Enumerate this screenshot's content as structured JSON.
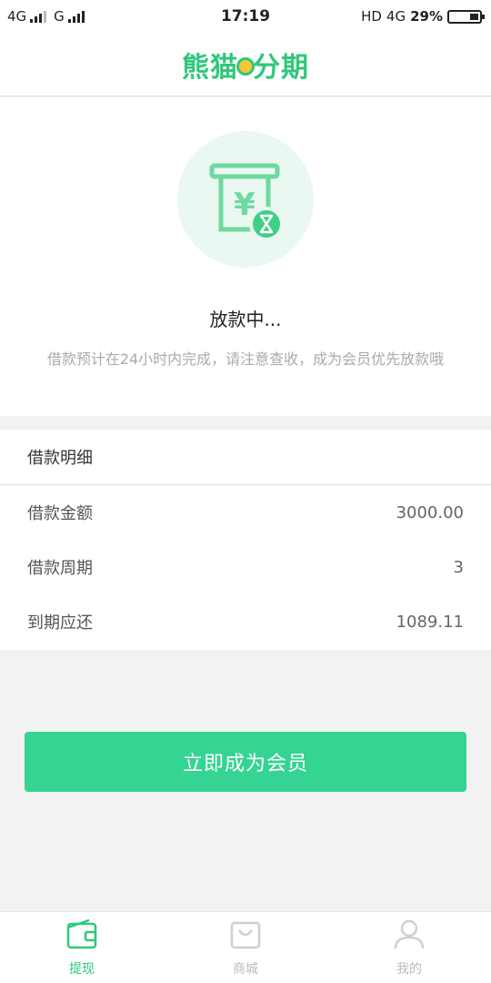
{
  "status_bar": {
    "network1": "4G",
    "network2": "G",
    "time": "17:19",
    "hd": "HD",
    "network3": "4G",
    "battery": "29%",
    "battery_level": 0.29
  },
  "header": {
    "logo_text_a": "熊猫",
    "logo_text_b": "分期"
  },
  "loan_status": {
    "icon": "atm-cash-hourglass-icon",
    "title": "放款中...",
    "description": "借款预计在24小时内完成，请注意查收，成为会员优先放款哦"
  },
  "details": {
    "header": "借款明细",
    "rows": [
      {
        "label": "借款金额",
        "value": "3000.00"
      },
      {
        "label": "借款周期",
        "value": "3"
      },
      {
        "label": "到期应还",
        "value": "1089.11"
      }
    ]
  },
  "cta": {
    "label": "立即成为会员"
  },
  "tabs": [
    {
      "label": "提现",
      "icon": "wallet-icon",
      "active": true
    },
    {
      "label": "商城",
      "icon": "shopping-bag-icon",
      "active": false
    },
    {
      "label": "我的",
      "icon": "user-icon",
      "active": false
    }
  ],
  "colors": {
    "brand": "#2fc87a",
    "button": "#35d492",
    "icon_bg": "#e9f8f0"
  }
}
